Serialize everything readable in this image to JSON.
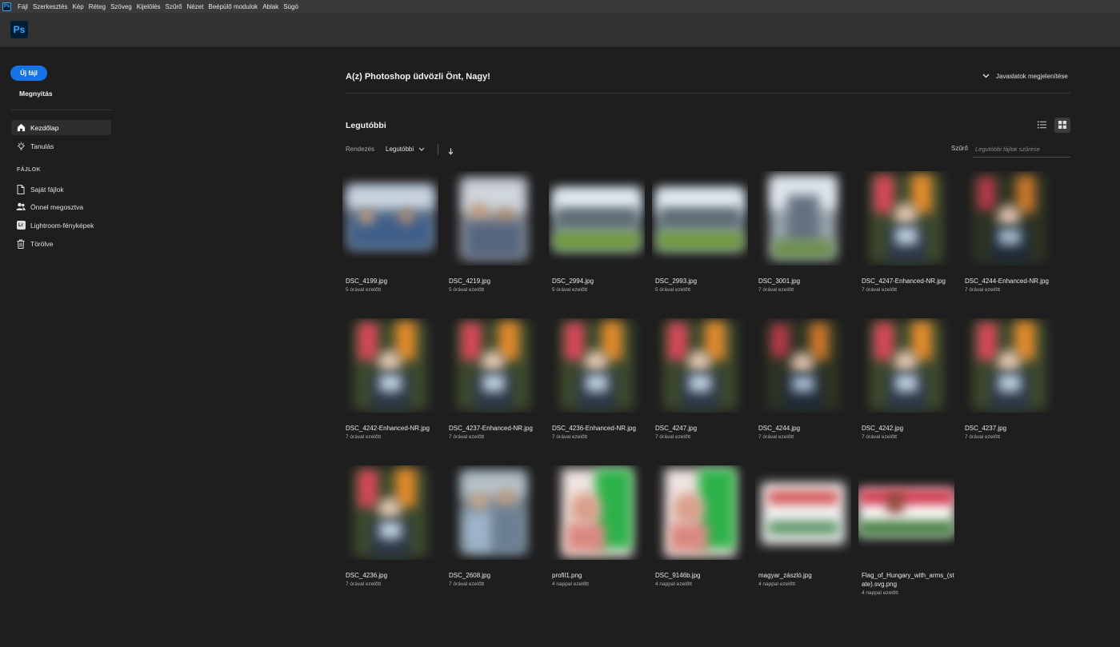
{
  "menubar": {
    "app_icon_label": "Ps",
    "items": [
      "Fájl",
      "Szerkesztés",
      "Kép",
      "Réteg",
      "Szöveg",
      "Kijelölés",
      "Szűrő",
      "Nézet",
      "Beépülő modulok",
      "Ablak",
      "Súgó"
    ]
  },
  "appbar": {
    "logo": "Ps"
  },
  "sidebar": {
    "new_file": "Új fájl",
    "open": "Megnyitás",
    "nav": [
      {
        "label": "Kezdőlap",
        "icon": "home-icon"
      },
      {
        "label": "Tanulás",
        "icon": "lightbulb-icon"
      }
    ],
    "files_section": "FÁJLOK",
    "files": [
      {
        "label": "Saját fájlok",
        "icon": "file-icon"
      },
      {
        "label": "Önnel megosztva",
        "icon": "shared-users-icon"
      },
      {
        "label": "Lightroom-fényképek",
        "icon": "lightroom-icon",
        "badge": "Lr"
      },
      {
        "label": "Törölve",
        "icon": "trash-icon"
      }
    ]
  },
  "main": {
    "welcome": "A(z) Photoshop üdvözli Önt, Nagy!",
    "suggestions_toggle": "Javaslatok megjelenítése",
    "recent_title": "Legutóbbi",
    "sort_label": "Rendezés",
    "sort_value": "Legutóbbi",
    "filter_label": "Szűrő",
    "filter_placeholder": "Legutóbbi fájlok szűrése"
  },
  "files": [
    {
      "name": "DSC_4199.jpg",
      "time": "5 órával ezelőtt",
      "thumb": "group"
    },
    {
      "name": "DSC_4219.jpg",
      "time": "5 órával ezelőtt",
      "thumb": "people"
    },
    {
      "name": "DSC_2994.jpg",
      "time": "5 órával ezelőtt",
      "thumb": "outdoor"
    },
    {
      "name": "DSC_2993.jpg",
      "time": "5 órával ezelőtt",
      "thumb": "outdoor"
    },
    {
      "name": "DSC_3001.jpg",
      "time": "7 órával ezelőtt",
      "thumb": "outdoor-portrait"
    },
    {
      "name": "DSC_4247-Enhanced-NR.jpg",
      "time": "7 órával ezelőtt",
      "thumb": "portrait"
    },
    {
      "name": "DSC_4244-Enhanced-NR.jpg",
      "time": "7 órával ezelőtt",
      "thumb": "portrait-dark"
    },
    {
      "name": "DSC_4242-Enhanced-NR.jpg",
      "time": "7 órával ezelőtt",
      "thumb": "portrait"
    },
    {
      "name": "DSC_4237-Enhanced-NR.jpg",
      "time": "7 órával ezelőtt",
      "thumb": "portrait"
    },
    {
      "name": "DSC_4236-Enhanced-NR.jpg",
      "time": "7 órával ezelőtt",
      "thumb": "portrait"
    },
    {
      "name": "DSC_4247.jpg",
      "time": "7 órával ezelőtt",
      "thumb": "portrait"
    },
    {
      "name": "DSC_4244.jpg",
      "time": "7 órával ezelőtt",
      "thumb": "portrait-dark"
    },
    {
      "name": "DSC_4242.jpg",
      "time": "7 órával ezelőtt",
      "thumb": "portrait"
    },
    {
      "name": "DSC_4237.jpg",
      "time": "7 órával ezelőtt",
      "thumb": "portrait"
    },
    {
      "name": "DSC_4236.jpg",
      "time": "7 órával ezelőtt",
      "thumb": "portrait"
    },
    {
      "name": "DSC_2608.jpg",
      "time": "7 órával ezelőtt",
      "thumb": "couple"
    },
    {
      "name": "profil1.png",
      "time": "4 nappal ezelőtt",
      "thumb": "profile-flag"
    },
    {
      "name": "DSC_9146b.jpg",
      "time": "4 nappal ezelőtt",
      "thumb": "profile-flag"
    },
    {
      "name": "magyar_zászló.jpg",
      "time": "4 nappal ezelőtt",
      "thumb": "flag-light"
    },
    {
      "name": "Flag_of_Hungary_with_arms_(state).svg.png",
      "time": "4 nappal ezelőtt",
      "thumb": "flag"
    }
  ],
  "colors": {
    "accent": "#1473e6",
    "menubar": "#3a3a3a",
    "appbar": "#323232",
    "background": "#1e1e1e",
    "ps_blue": "#31a8ff"
  }
}
